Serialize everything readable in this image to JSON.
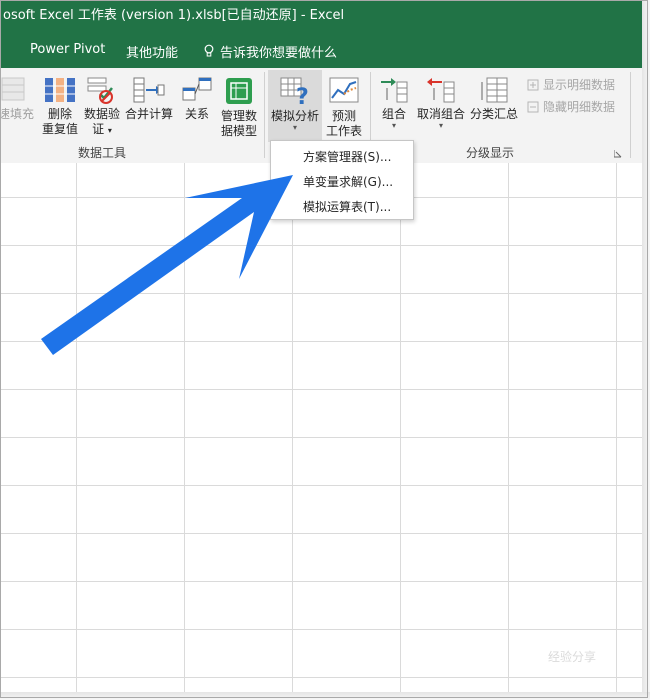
{
  "title_bar": {
    "text": "osoft Excel 工作表 (version 1).xlsb[已自动还原]  -  Excel"
  },
  "menu": {
    "items": [
      "Power Pivot",
      "其他功能"
    ],
    "tell_me": "告诉我你想要做什么"
  },
  "ribbon": {
    "data_tools": {
      "label": "数据工具",
      "buttons": [
        {
          "line1": "速填充",
          "icon": "flash-fill-icon"
        },
        {
          "line1": "删除",
          "line2": "重复值",
          "icon": "remove-duplicates-icon"
        },
        {
          "line1": "数据验",
          "line2": "证",
          "icon": "data-validation-icon",
          "caret": "▾"
        },
        {
          "line1": "合并计算",
          "icon": "consolidate-icon"
        },
        {
          "line1": "关系",
          "icon": "relationships-icon"
        },
        {
          "line1": "管理数",
          "line2": "据模型",
          "icon": "data-model-icon"
        }
      ]
    },
    "forecast": {
      "buttons": [
        {
          "line1": "模拟分析",
          "icon": "what-if-analysis-icon",
          "caret": "▾"
        },
        {
          "line1": "预测",
          "line2": "工作表",
          "icon": "forecast-sheet-icon"
        }
      ]
    },
    "outline": {
      "label": "分级显示",
      "buttons": [
        {
          "line1": "组合",
          "icon": "group-icon",
          "caret": "▾"
        },
        {
          "line1": "取消组合",
          "icon": "ungroup-icon",
          "caret": "▾"
        },
        {
          "line1": "分类汇总",
          "icon": "subtotal-icon"
        }
      ],
      "side_items": [
        "显示明细数据",
        "隐藏明细数据"
      ]
    }
  },
  "dropdown": {
    "items": [
      "方案管理器(S)...",
      "单变量求解(G)...",
      "模拟运算表(T)..."
    ]
  },
  "watermark": {
    "text": "经验分享"
  },
  "colors": {
    "excel_green": "#217346",
    "arrow_blue": "#1e73e8"
  }
}
